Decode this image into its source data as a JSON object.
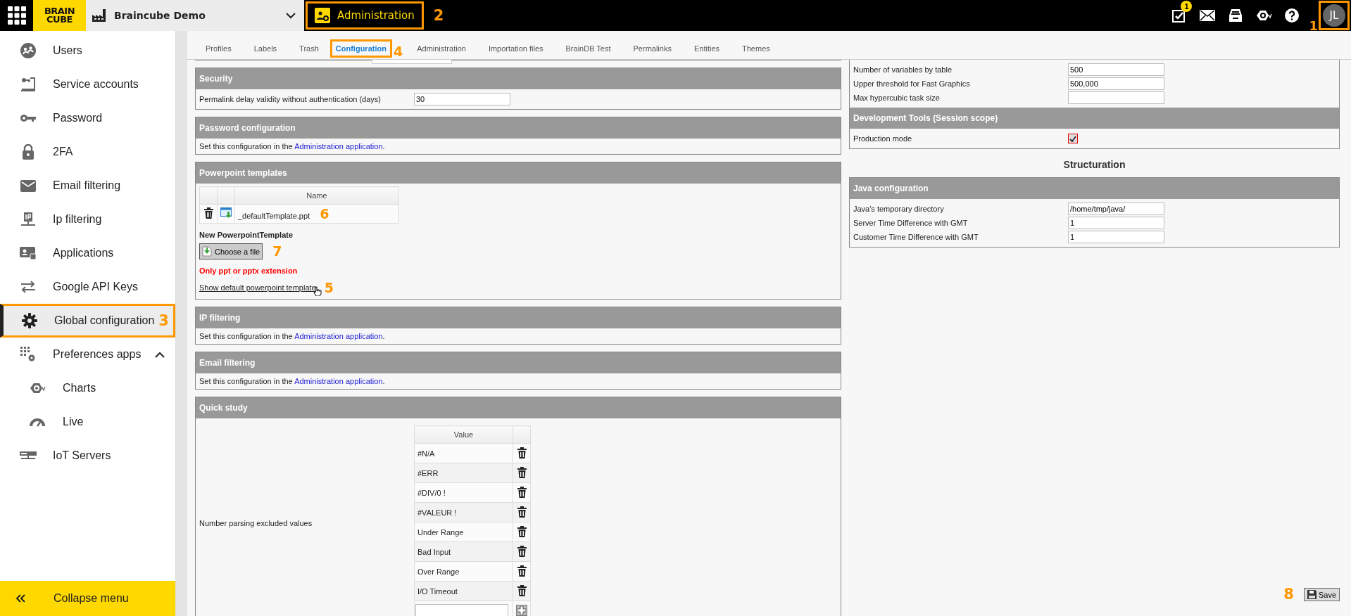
{
  "top_bar": {
    "logo": [
      "BRAIN",
      "CUBE"
    ],
    "app_name": "Braincube Demo",
    "app_button": {
      "label": "Administration",
      "callout": {
        "number": "2",
        "boxed": true
      }
    },
    "notification_count": "1",
    "avatar": "JL",
    "avatar_callout": {
      "number": "1",
      "boxed": true
    }
  },
  "sidebar": {
    "items": [
      {
        "label": "Users",
        "selected": false
      },
      {
        "label": "Service accounts",
        "selected": false
      },
      {
        "label": "Password",
        "selected": false
      },
      {
        "label": "2FA",
        "selected": false
      },
      {
        "label": "Email filtering",
        "selected": false
      },
      {
        "label": "Ip filtering",
        "selected": false
      },
      {
        "label": "Applications",
        "selected": false
      },
      {
        "label": "Google API Keys",
        "selected": false
      },
      {
        "label": "Global configuration",
        "selected": true,
        "callout": {
          "number": "3",
          "boxed": true
        }
      },
      {
        "label": "Preferences apps",
        "selected": false,
        "expanded": true,
        "children": [
          {
            "label": "Charts",
            "selected": false
          },
          {
            "label": "Live",
            "selected": false
          }
        ]
      },
      {
        "label": "IoT Servers",
        "selected": false
      }
    ],
    "collapse": "Collapse menu"
  },
  "tabs": [
    {
      "label": "Profiles",
      "selected": false
    },
    {
      "label": "Labels",
      "selected": false
    },
    {
      "label": "Trash",
      "selected": false
    },
    {
      "label": "Configuration",
      "selected": true,
      "callout": {
        "number": "4",
        "boxed": true
      }
    },
    {
      "label": "Administration",
      "selected": false
    },
    {
      "label": "Importation files",
      "selected": false
    },
    {
      "label": "BrainDB Test",
      "selected": false
    },
    {
      "label": "Permalinks",
      "selected": false
    },
    {
      "label": "Entities",
      "selected": false
    },
    {
      "label": "Themes",
      "selected": false
    }
  ],
  "left_sections": [
    {
      "kind": "cut"
    },
    {
      "kind": "form",
      "title": "Security",
      "rows": [
        {
          "kind": "input",
          "label": "Permalink delay validity without authentication (days)",
          "value": "30"
        }
      ]
    },
    {
      "kind": "note",
      "title": "Password configuration",
      "text": "Set this configuration in the",
      "link": "Administration application",
      "end": "."
    },
    {
      "kind": "templates",
      "title": "Powerpoint templates",
      "column": "Name",
      "files": [
        {
          "name": "_defaultTemplate.ppt",
          "callout": {
            "number": "6",
            "boxed": false
          }
        }
      ],
      "new_label": "New PowerpointTemplate",
      "choose": {
        "label": "Choose a file",
        "callout": {
          "number": "7",
          "boxed": false
        }
      },
      "warning": "Only ppt or pptx extension",
      "show_link": {
        "label": "Show default powerpoint template",
        "callout": {
          "number": "5",
          "boxed": false
        }
      }
    },
    {
      "kind": "note",
      "title": "IP filtering",
      "text": "Set this configuration in the",
      "link": "Administration application",
      "end": "."
    },
    {
      "kind": "note",
      "title": "Email filtering",
      "text": "Set this configuration in the",
      "link": "Administration application",
      "end": "."
    },
    {
      "kind": "quick",
      "title": "Quick study",
      "label": "Number parsing excluded values",
      "column": "Value",
      "values": [
        "#N/A",
        "#ERR",
        "#DIV/0 !",
        "#VALEUR !",
        "Under Range",
        "Bad Input",
        "Over Range",
        "I/O Timeout"
      ]
    }
  ],
  "right_sections": [
    {
      "kind": "form",
      "rows": [
        {
          "kind": "input",
          "label": "Number of variables by table",
          "value": "500"
        },
        {
          "kind": "input",
          "label": "Upper threshold for Fast Graphics",
          "value": "500,000"
        },
        {
          "kind": "input",
          "label": "Max hypercubic task size",
          "value": ""
        }
      ]
    },
    {
      "kind": "form",
      "title": "Development Tools (Session scope)",
      "rows": [
        {
          "kind": "checkbox",
          "label": "Production mode",
          "checked": true
        }
      ]
    },
    {
      "kind": "heading",
      "title": "Structuration"
    },
    {
      "kind": "form",
      "title": "Java configuration",
      "rows": [
        {
          "kind": "input",
          "label": "Java's temporary directory",
          "value": "/home/tmp/java/"
        },
        {
          "kind": "input",
          "label": "Server Time Difference with GMT",
          "value": "1"
        },
        {
          "kind": "input",
          "label": "Customer Time Difference with GMT",
          "value": "1"
        }
      ]
    }
  ],
  "save": {
    "label": "Save",
    "callout": {
      "number": "8",
      "boxed": false
    }
  }
}
